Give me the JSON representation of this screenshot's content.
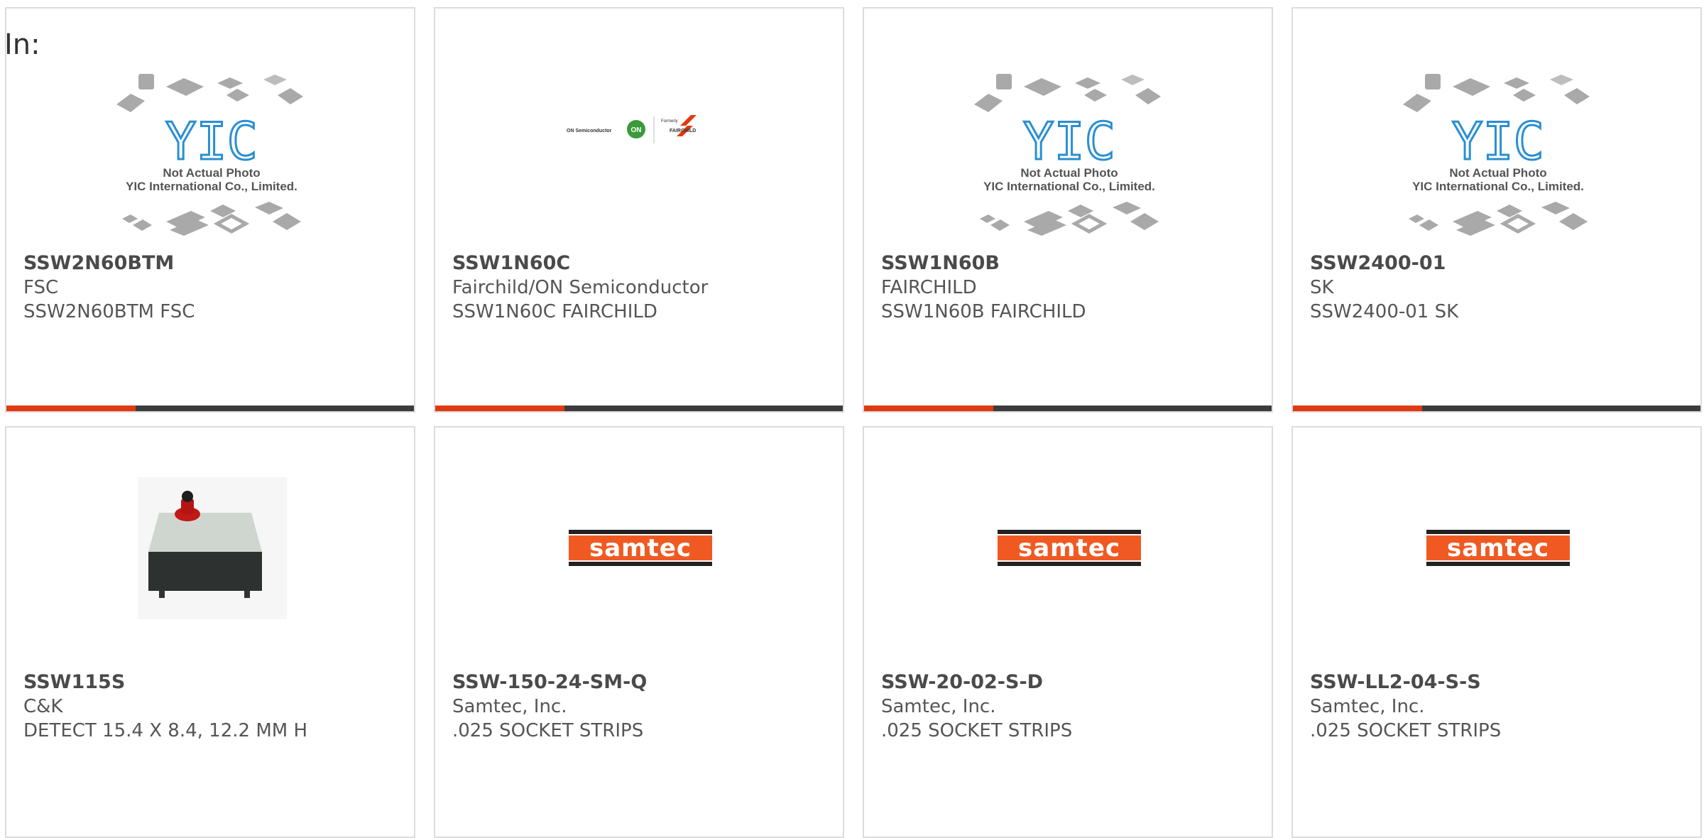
{
  "header": {
    "in_label": "In:"
  },
  "placeholder": {
    "line1": "Not Actual Photo",
    "line2": "YIC International Co., Limited.",
    "logo_text": "YIC"
  },
  "brand_logos": {
    "on_semi_text": "ON Semiconductor",
    "on_badge": "ON",
    "formerly": "Formerly",
    "fairchild": "FAIRCHILD",
    "samtec": "samtec"
  },
  "colors": {
    "accent": "#e03a12",
    "bar": "#3c3c3c",
    "samtec": "#f05a22"
  },
  "products": [
    {
      "part_number": "SSW2N60BTM",
      "manufacturer": "FSC",
      "description": "SSW2N60BTM FSC",
      "image": "yic-placeholder"
    },
    {
      "part_number": "SSW1N60C",
      "manufacturer": "Fairchild/ON Semiconductor",
      "description": "SSW1N60C FAIRCHILD",
      "image": "on-fairchild-logo"
    },
    {
      "part_number": "SSW1N60B",
      "manufacturer": "FAIRCHILD",
      "description": "SSW1N60B FAIRCHILD",
      "image": "yic-placeholder"
    },
    {
      "part_number": "SSW2400-01",
      "manufacturer": "SK",
      "description": "SSW2400-01 SK",
      "image": "yic-placeholder"
    },
    {
      "part_number": "SSW115S",
      "manufacturer": "C&K",
      "description": "DETECT 15.4 X 8.4, 12.2 MM H",
      "image": "switch-photo"
    },
    {
      "part_number": "SSW-150-24-SM-Q",
      "manufacturer": "Samtec, Inc.",
      "description": ".025 SOCKET STRIPS",
      "image": "samtec-logo"
    },
    {
      "part_number": "SSW-20-02-S-D",
      "manufacturer": "Samtec, Inc.",
      "description": ".025 SOCKET STRIPS",
      "image": "samtec-logo"
    },
    {
      "part_number": "SSW-LL2-04-S-S",
      "manufacturer": "Samtec, Inc.",
      "description": ".025 SOCKET STRIPS",
      "image": "samtec-logo"
    }
  ]
}
